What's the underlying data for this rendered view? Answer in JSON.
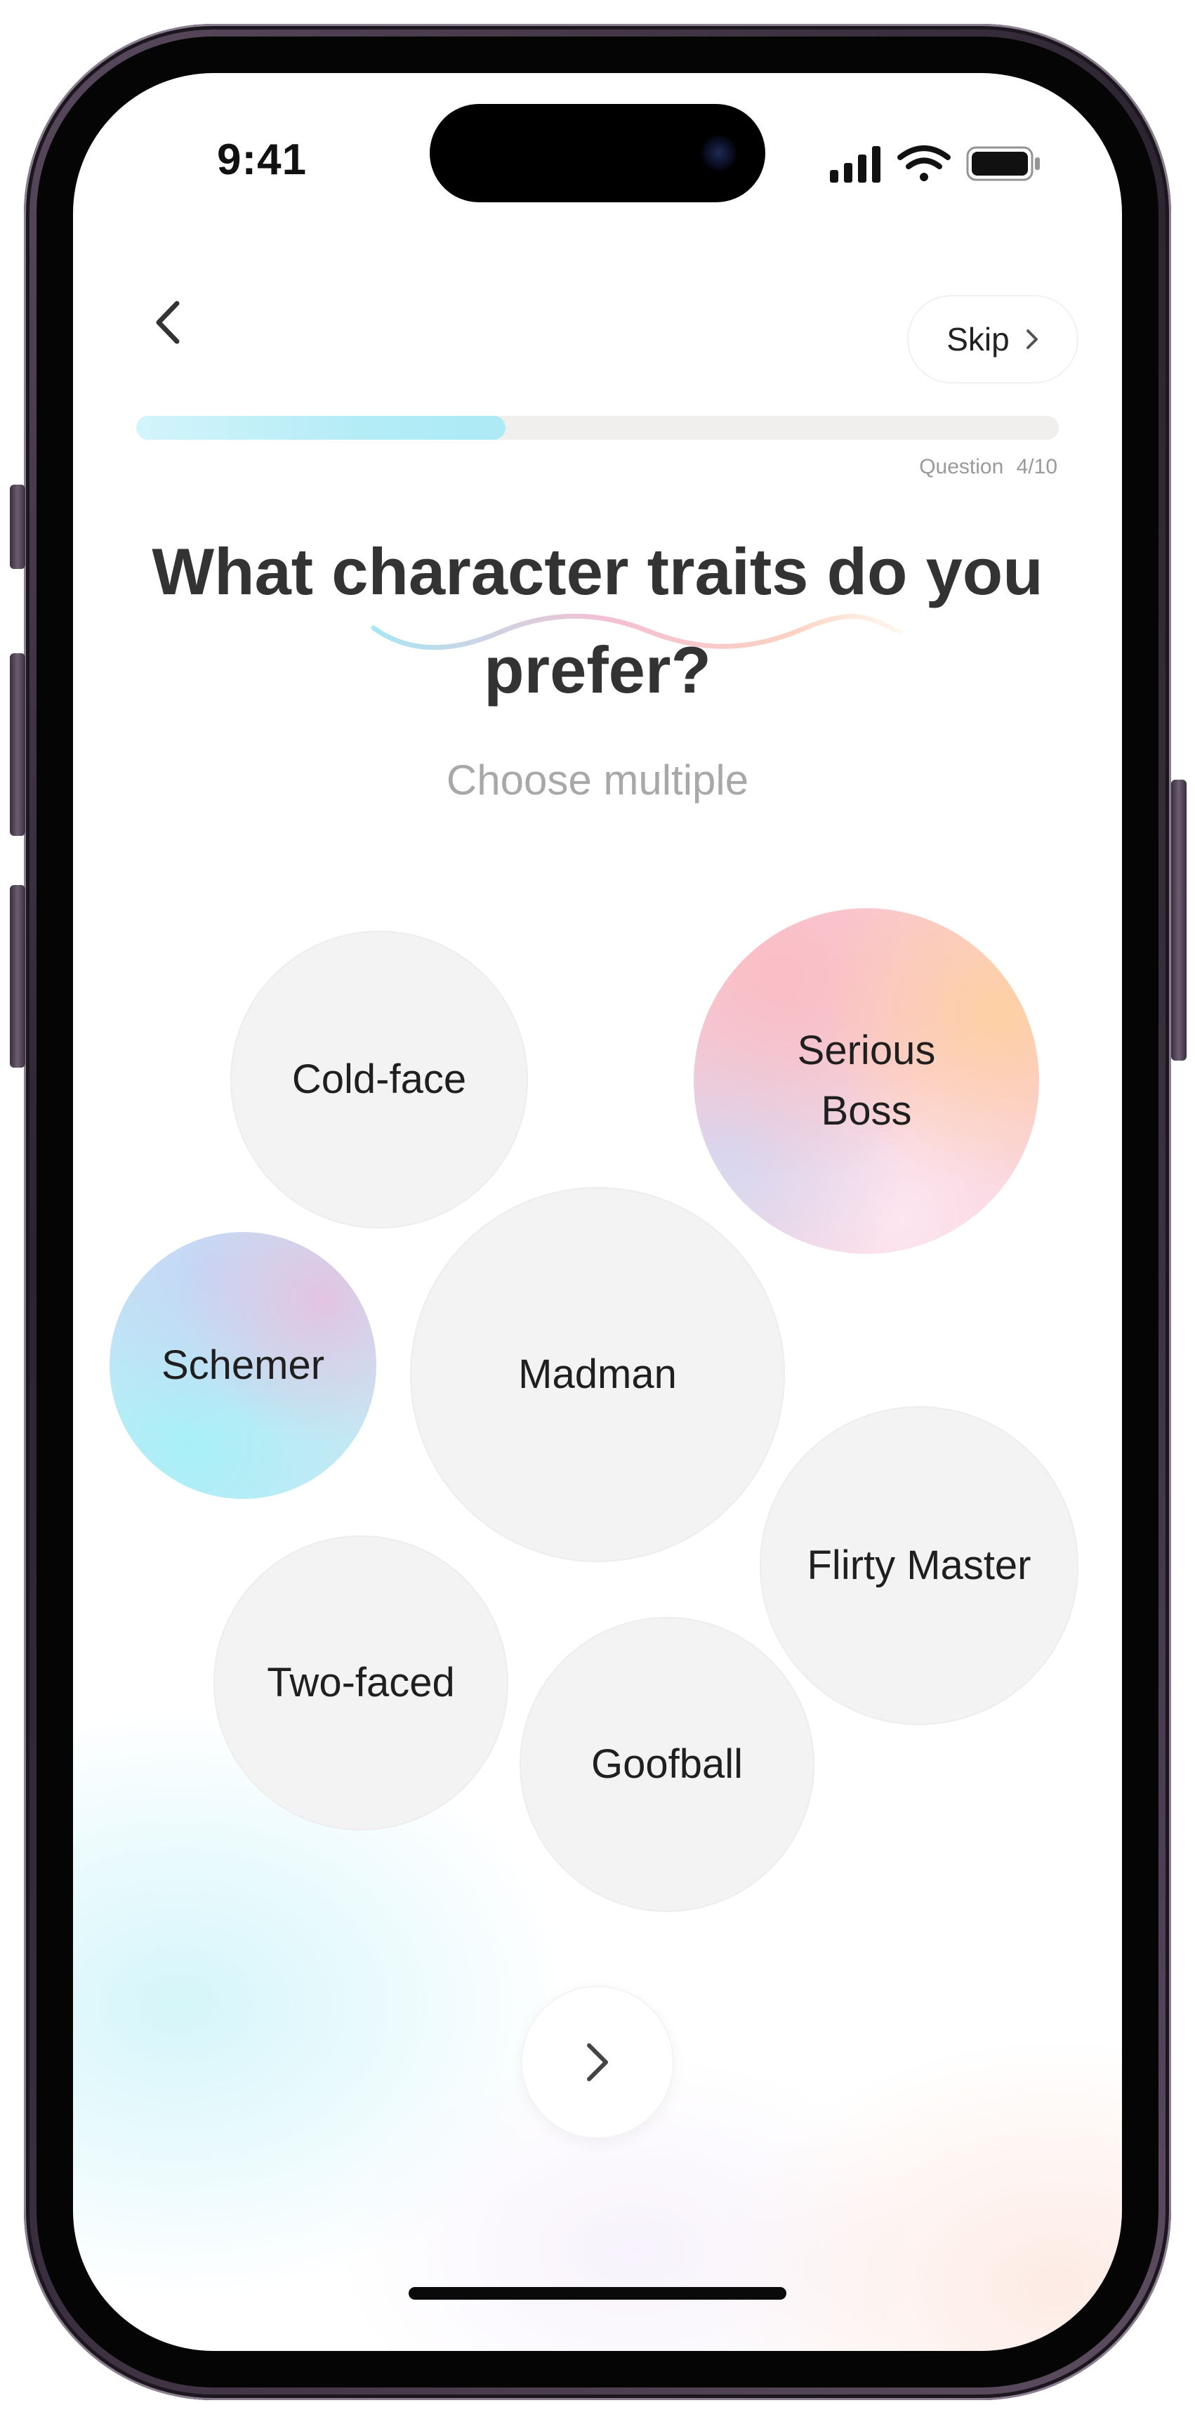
{
  "status_bar": {
    "time": "9:41"
  },
  "header": {
    "back_icon": "chevron-left-icon",
    "skip_label": "Skip",
    "skip_icon": "chevron-right-icon"
  },
  "progress": {
    "label": "Question 4/10",
    "fraction": 0.4,
    "fill_color": "#b4ecf6",
    "track_color": "#f1eeee"
  },
  "question": {
    "title": "What character traits do you prefer?",
    "subtitle": "Choose multiple"
  },
  "options": [
    {
      "label": "Cold-face",
      "selected": false
    },
    {
      "label": "Serious Boss",
      "selected": true
    },
    {
      "label": "Schemer",
      "selected": true
    },
    {
      "label": "Madman",
      "selected": false
    },
    {
      "label": "Flirty Master",
      "selected": false
    },
    {
      "label": "Two-faced",
      "selected": false
    },
    {
      "label": "Goofball",
      "selected": false
    }
  ],
  "next_button": {
    "icon": "chevron-right-icon"
  },
  "colors": {
    "text_primary": "#333333",
    "text_secondary": "#a8a8a8",
    "bubble_default": "#f3f3f3",
    "selected_warm": "#f9cdd6",
    "selected_cool": "#c4e8f4"
  }
}
